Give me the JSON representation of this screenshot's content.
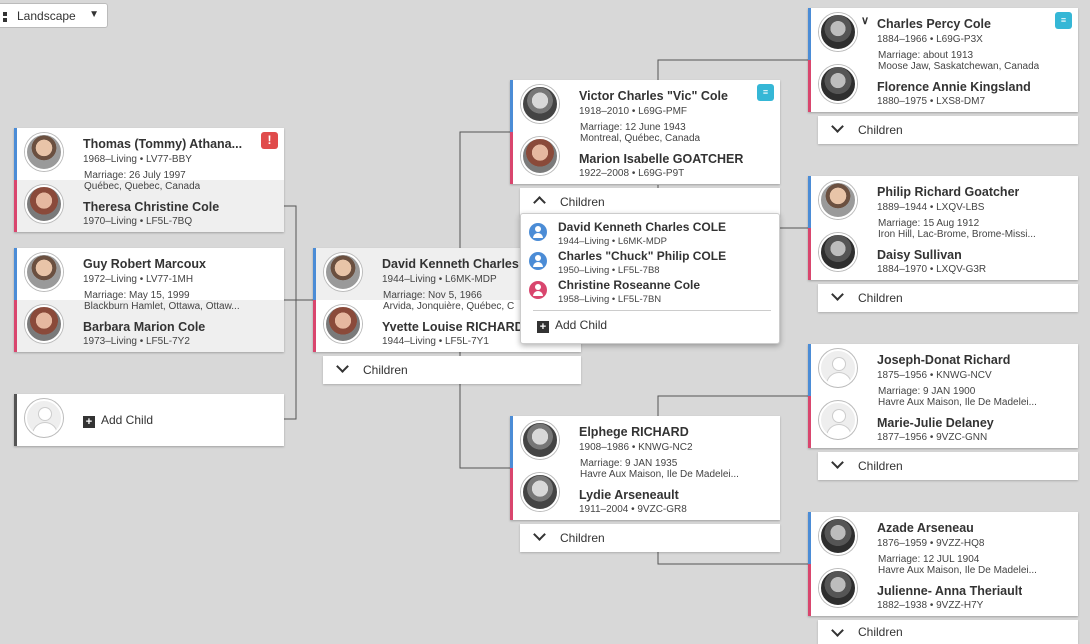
{
  "view_selector": {
    "label": "Landscape"
  },
  "ui": {
    "children_label": "Children",
    "add_child_label": "Add Child"
  },
  "families": {
    "child_couple_1": {
      "husband": {
        "name": "Thomas (Tommy) Athana...",
        "dates": "1968–Living • LV77-BBY"
      },
      "marriage": {
        "date": "Marriage: 26 July 1997",
        "place": "Québec, Quebec, Canada"
      },
      "wife": {
        "name": "Theresa Christine Cole",
        "dates": "1970–Living • LF5L-7BQ"
      },
      "flag": "!"
    },
    "child_couple_2": {
      "husband": {
        "name": "Guy Robert Marcoux",
        "dates": "1972–Living • LV77-1MH"
      },
      "marriage": {
        "date": "Marriage: May 15, 1999",
        "place": "Blackburn Hamlet, Ottawa, Ottaw..."
      },
      "wife": {
        "name": "Barbara Marion Cole",
        "dates": "1973–Living • LF5L-7Y2"
      }
    },
    "focus": {
      "husband": {
        "name": "David Kenneth Charles",
        "dates": "1944–Living • L6MK-MDP"
      },
      "marriage": {
        "date": "Marriage: Nov 5, 1966",
        "place": "Arvida, Jonquière, Québec, C"
      },
      "wife": {
        "name": "Yvette Louise RICHARD",
        "dates": "1944–Living • LF5L-7Y1"
      }
    },
    "father_parents": {
      "husband": {
        "name": "Victor Charles \"Vic\" Cole",
        "dates": "1918–2010 • L69G-PMF"
      },
      "marriage": {
        "date": "Marriage: 12 June 1943",
        "place": "Montreal, Québec, Canada"
      },
      "wife": {
        "name": "Marion Isabelle GOATCHER",
        "dates": "1922–2008 • L69G-P9T"
      }
    },
    "mother_parents": {
      "husband": {
        "name": "Elphege RICHARD",
        "dates": "1908–1986 • KNWG-NC2"
      },
      "marriage": {
        "date": "Marriage: 9 JAN 1935",
        "place": "Havre Aux Maison, Ile De Madelei..."
      },
      "wife": {
        "name": "Lydie Arseneault",
        "dates": "1911–2004 • 9VZC-GR8"
      }
    },
    "gp_1": {
      "husband": {
        "name": "Charles Percy Cole",
        "dates": "1884–1966 • L69G-P3X"
      },
      "marriage": {
        "date": "Marriage: about 1913",
        "place": "Moose Jaw, Saskatchewan, Canada"
      },
      "wife": {
        "name": "Florence Annie Kingsland",
        "dates": "1880–1975 • LXS8-DM7"
      }
    },
    "gp_2": {
      "husband": {
        "name": "Philip Richard Goatcher",
        "dates": "1889–1944 • LXQV-LBS"
      },
      "marriage": {
        "date": "Marriage: 15 Aug 1912",
        "place": "Iron Hill, Lac-Brome, Brome-Missi..."
      },
      "wife": {
        "name": "Daisy Sullivan",
        "dates": "1884–1970 • LXQV-G3R"
      }
    },
    "gp_3": {
      "husband": {
        "name": "Joseph-Donat Richard",
        "dates": "1875–1956 • KNWG-NCV"
      },
      "marriage": {
        "date": "Marriage: 9 JAN 1900",
        "place": "Havre Aux Maison, Ile De Madelei..."
      },
      "wife": {
        "name": "Marie-Julie Delaney",
        "dates": "1877–1956 • 9VZC-GNN"
      }
    },
    "gp_4": {
      "husband": {
        "name": "Azade Arseneau",
        "dates": "1876–1959 • 9VZZ-HQ8"
      },
      "marriage": {
        "date": "Marriage: 12 JUL 1904",
        "place": "Havre Aux Maison, Ile De Madelei..."
      },
      "wife": {
        "name": "Julienne- Anna Theriault",
        "dates": "1882–1938 • 9VZZ-H7Y"
      }
    }
  },
  "children_popup": {
    "children": [
      {
        "name": "David Kenneth Charles COLE",
        "dates": "1944–Living • L6MK-MDP",
        "sex": "male"
      },
      {
        "name": "Charles \"Chuck\" Philip COLE",
        "dates": "1950–Living • LF5L-7B8",
        "sex": "male"
      },
      {
        "name": "Christine Roseanne Cole",
        "dates": "1958–Living • LF5L-7BN",
        "sex": "female"
      }
    ]
  },
  "colors": {
    "male": "#4b8cd6",
    "female": "#d9466e",
    "alert": "#e04b4b",
    "hint": "#35b7d6",
    "background": "#d8d8d8"
  }
}
